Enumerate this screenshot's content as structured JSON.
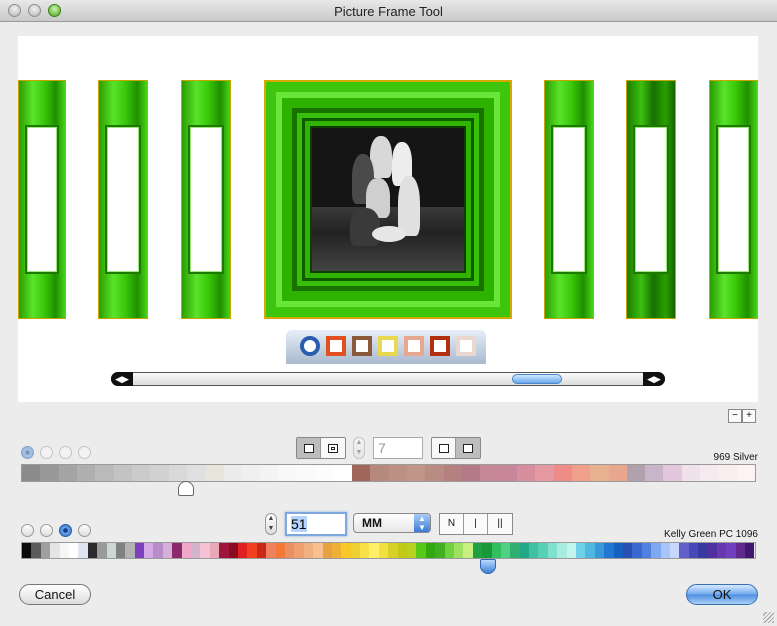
{
  "window": {
    "title": "Picture Frame Tool"
  },
  "mat": {
    "count": "7",
    "color_name": "969 Silver",
    "swatches": [
      "#8c8c8c",
      "#999",
      "#a4a4a4",
      "#afafaf",
      "#bababa",
      "#c3c3c3",
      "#cbcbcb",
      "#d2d2d2",
      "#d9d9d9",
      "#e0e0e0",
      "#e6e5dc",
      "#ebebeb",
      "#f0f0f0",
      "#f4f4f4",
      "#f8f8f8",
      "#fafafa",
      "#fcfcfc",
      "#fefefe",
      "#a0685d",
      "#b6897d",
      "#bd9085",
      "#c09688",
      "#b88b83",
      "#b48080",
      "#b57a88",
      "#c68897",
      "#c8869a",
      "#d78fa0",
      "#e59aa2",
      "#f08c88",
      "#f0a08a",
      "#e7b08f",
      "#eaa78f",
      "#b0a2ac",
      "#c9b5c9",
      "#e2c7dd",
      "#efe2ea",
      "#f5ebef",
      "#f9eeee",
      "#fdf3f3"
    ],
    "pointer_fraction": 0.225
  },
  "frame": {
    "width_value": "51",
    "unit": "MM",
    "moulding_labels": [
      "N",
      "|",
      "||"
    ],
    "color_name": "Kelly Green PC 1096",
    "swatches": [
      "#0a0a0a",
      "#5b5b5b",
      "#a0a0a0",
      "#e4e4e4",
      "#f6f6f6",
      "#ffffff",
      "#dfe6f2",
      "#2b2b2b",
      "#9a9a9a",
      "#cdd7d8",
      "#808080",
      "#b3b3b3",
      "#7c3fbd",
      "#d4a9e6",
      "#b78ec9",
      "#d6b0d8",
      "#8a2a6a",
      "#f0a8c8",
      "#d2b4cc",
      "#f4c2d4",
      "#e8a8b8",
      "#a0143c",
      "#8a0c20",
      "#e02020",
      "#f24020",
      "#c82818",
      "#f08060",
      "#f47838",
      "#e89060",
      "#f0a070",
      "#f0b080",
      "#f8c090",
      "#e8a040",
      "#f0b038",
      "#f8c828",
      "#f0d030",
      "#f8e048",
      "#fff068",
      "#f0e040",
      "#d8d028",
      "#c0c818",
      "#b8d020",
      "#58c818",
      "#30a810",
      "#40b020",
      "#70d040",
      "#a0e060",
      "#c8f080",
      "#20a040",
      "#189838",
      "#30c060",
      "#50d080",
      "#30b070",
      "#20a888",
      "#40c0a0",
      "#58d0b8",
      "#80e0d0",
      "#a8ece0",
      "#c0f4ec",
      "#70d0e8",
      "#50b8e0",
      "#3898d8",
      "#2078d0",
      "#1860c0",
      "#2850b0",
      "#3868d0",
      "#5080e0",
      "#80a8f0",
      "#a8c4f8",
      "#c8d8fc",
      "#6060c8",
      "#4848b8",
      "#3838a0",
      "#5030a0",
      "#6838b0",
      "#7040c0",
      "#602890",
      "#401870"
    ],
    "pointer_fraction": 0.635
  },
  "buttons": {
    "cancel": "Cancel",
    "ok": "OK"
  },
  "colors": {
    "frame_green": "#3ec60e",
    "frame_edge": "#d4a900"
  }
}
